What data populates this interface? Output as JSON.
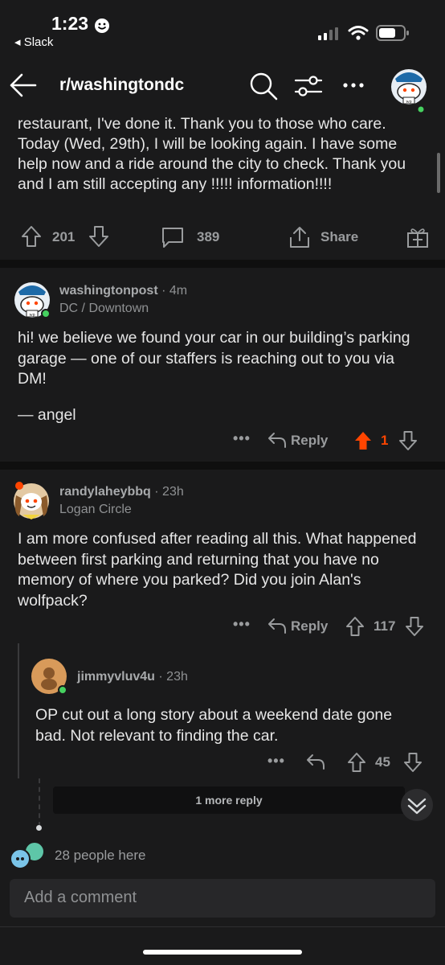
{
  "status_bar": {
    "time": "1:23",
    "back_app": "◂ Slack"
  },
  "header": {
    "subreddit": "r/washingtondc"
  },
  "post": {
    "body_text": "restaurant, I've done it. Thank you to those who care. Today (Wed, 29th), I will be looking again. I have some help now and a ride around the city to check. Thank you and I am still accepting any !!!!! information!!!!",
    "votes": "201",
    "comments": "389",
    "share_label": "Share"
  },
  "comments": [
    {
      "author": "washingtonpost",
      "time": "· 4m",
      "flair": "DC / Downtown",
      "body": "hi! we believe we found your car in our building’s parking garage — one of our staffers is reaching out to you via DM!",
      "signature": "— angel",
      "reply_label": "Reply",
      "votes": "1"
    },
    {
      "author": "randylaheybbq",
      "time": "· 23h",
      "flair": "Logan Circle",
      "body": "I am more confused after reading all this. What happened between first parking and returning that you have no memory of where you parked? Did you join Alan's wolfpack?",
      "reply_label": "Reply",
      "votes": "117"
    },
    {
      "author": "jimmyvluv4u",
      "time": "· 23h",
      "body": "OP cut out a long story about a weekend date gone bad.  Not relevant to finding the car.",
      "votes": "45"
    }
  ],
  "more_replies": "1 more reply",
  "presence": "28 people here",
  "comment_input": {
    "placeholder": "Add a comment"
  },
  "colors": {
    "background": "#1a1a1b",
    "upvote_active": "#ff4500",
    "divider": "#0f0f0f"
  }
}
